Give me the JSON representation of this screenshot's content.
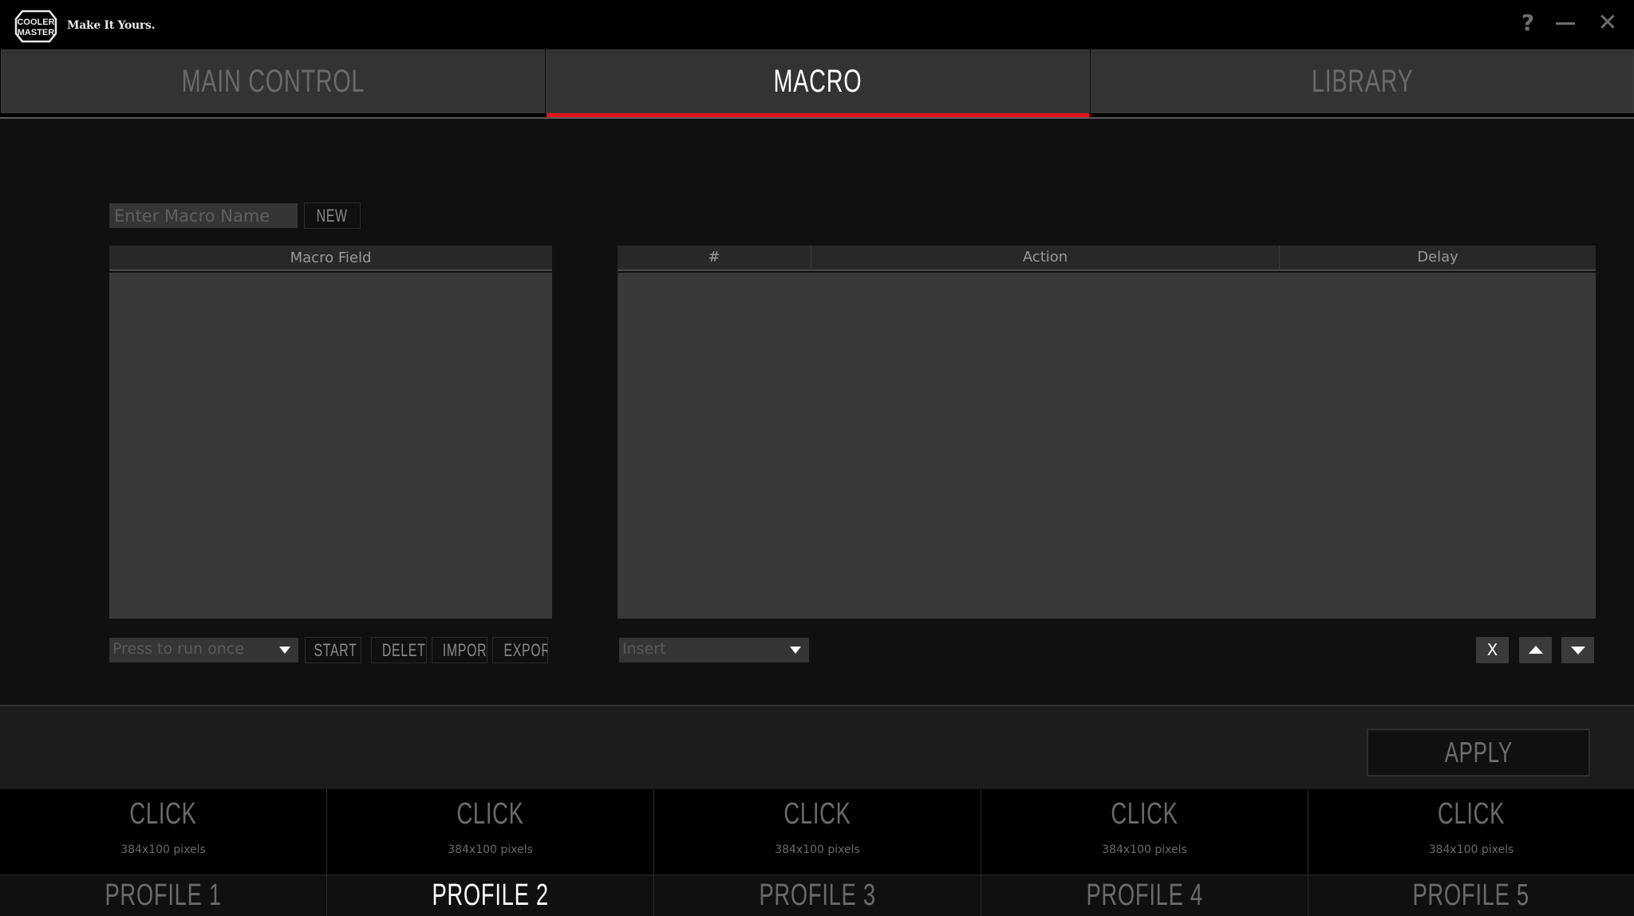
{
  "titlebar": {
    "brand_line1": "COOLER",
    "brand_line2": "MASTER",
    "tagline": "Make It Yours.",
    "help_icon": "?",
    "close_icon": "✕"
  },
  "tabs": [
    {
      "label": "MAIN CONTROL",
      "active": false
    },
    {
      "label": "MACRO",
      "active": true
    },
    {
      "label": "LIBRARY",
      "active": false
    }
  ],
  "accent_color": "#e0151b",
  "macro": {
    "name_input": {
      "value": "",
      "placeholder": "Enter Macro Name"
    },
    "new_label": "NEW",
    "field_header": "Macro Field",
    "run_mode": {
      "selected": "Press to run once"
    },
    "start_label": "START",
    "delete_label": "DELETE",
    "import_label": "IMPORT",
    "export_label": "EXPORT"
  },
  "action_table": {
    "columns": [
      "#",
      "Action",
      "Delay"
    ],
    "rows": [],
    "insert_select": {
      "selected": "Insert"
    },
    "remove_label": "X",
    "move_up_icon": "triangle-up",
    "move_down_icon": "triangle-down"
  },
  "apply_label": "APPLY",
  "profiles": [
    {
      "image_label": "CLICK",
      "image_dims": "384x100 pixels",
      "name": "PROFILE 1",
      "active": false
    },
    {
      "image_label": "CLICK",
      "image_dims": "384x100 pixels",
      "name": "PROFILE 2",
      "active": true
    },
    {
      "image_label": "CLICK",
      "image_dims": "384x100 pixels",
      "name": "PROFILE 3",
      "active": false
    },
    {
      "image_label": "CLICK",
      "image_dims": "384x100 pixels",
      "name": "PROFILE 4",
      "active": false
    },
    {
      "image_label": "CLICK",
      "image_dims": "384x100 pixels",
      "name": "PROFILE 5",
      "active": false
    }
  ]
}
